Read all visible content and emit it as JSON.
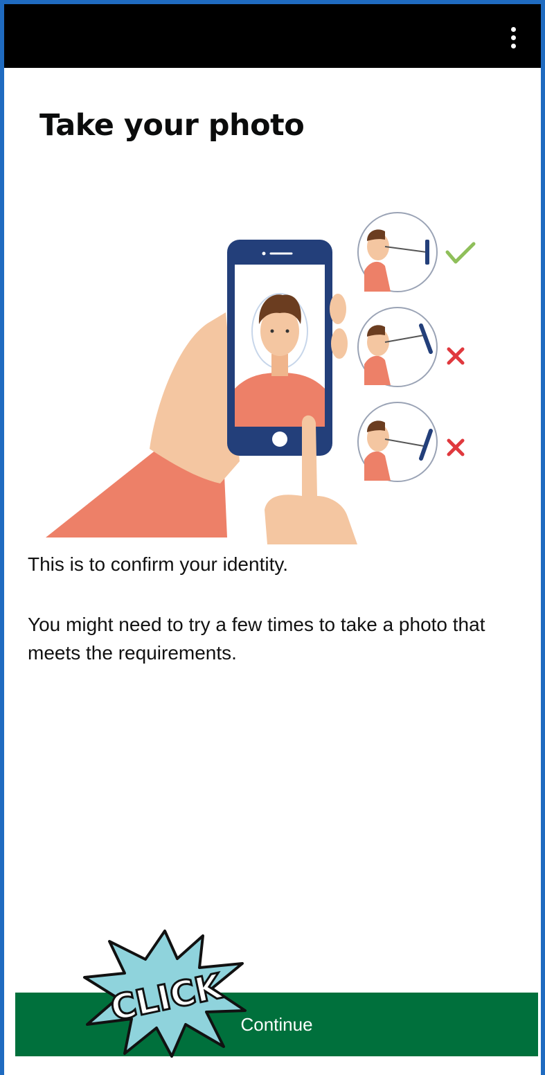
{
  "header": {
    "menu_icon": "more-vertical-icon",
    "background": "#000000"
  },
  "page": {
    "title": "Take your photo",
    "paragraph_1": "This is to confirm your identity.",
    "paragraph_2": "You might need to try a few times to take a photo that meets the requirements."
  },
  "illustration": {
    "icons": [
      "phone-selfie-illustration",
      "check-icon",
      "cross-icon",
      "cross-icon"
    ]
  },
  "button": {
    "continue_label": "Continue",
    "color": "#00703c"
  },
  "sticker": {
    "text": "CLICK"
  }
}
